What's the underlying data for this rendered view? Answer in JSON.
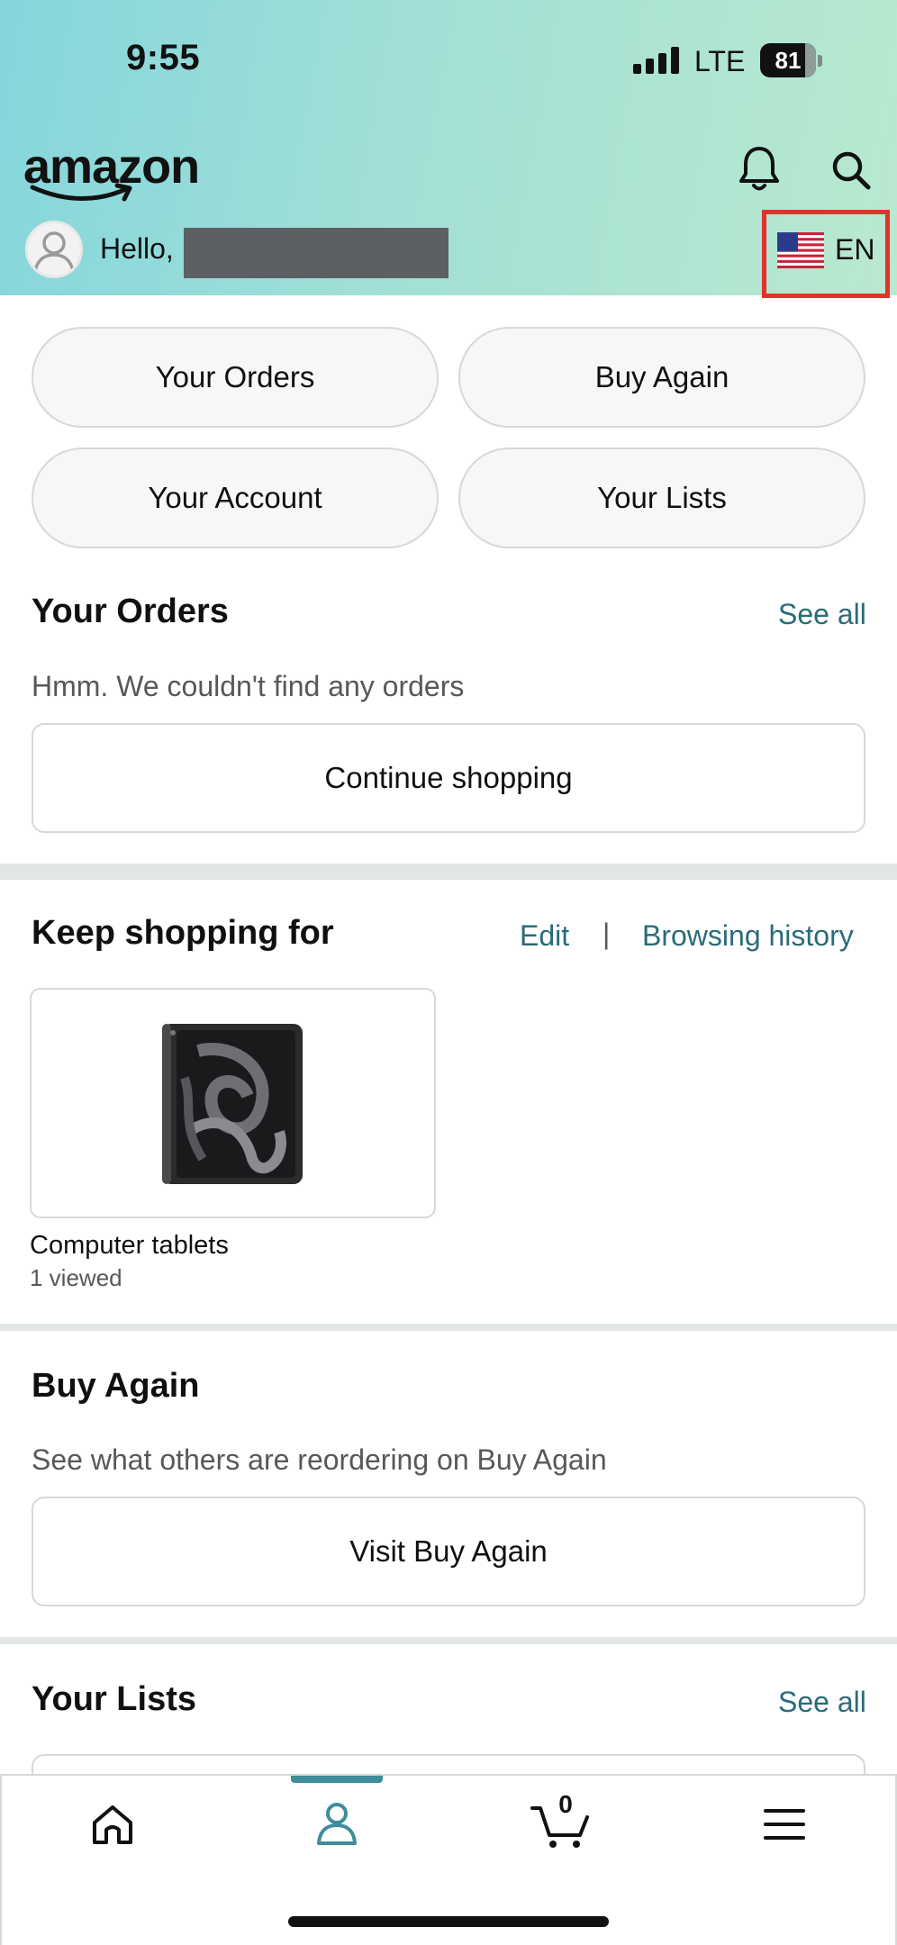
{
  "status_bar": {
    "time": "9:55",
    "network": "LTE",
    "battery": "81"
  },
  "header": {
    "logo_text": "amazon",
    "greeting": "Hello,",
    "language": "EN",
    "icons": {
      "notifications": "bell-icon",
      "search": "search-icon",
      "flag": "us-flag-icon"
    }
  },
  "quick_actions": [
    "Your Orders",
    "Buy Again",
    "Your Account",
    "Your Lists"
  ],
  "orders": {
    "title": "Your Orders",
    "see_all": "See all",
    "empty_message": "Hmm. We couldn't find any orders",
    "button": "Continue shopping"
  },
  "keep_shopping": {
    "title": "Keep shopping for",
    "edit": "Edit",
    "separator": "|",
    "history": "Browsing history",
    "item": {
      "name": "Computer tablets",
      "viewed": "1 viewed"
    }
  },
  "buy_again": {
    "title": "Buy Again",
    "message": "See what others are reordering on Buy Again",
    "button": "Visit Buy Again"
  },
  "lists": {
    "title": "Your Lists",
    "see_all": "See all"
  },
  "bottom_nav": {
    "items": [
      "home-icon",
      "account-icon",
      "cart-icon",
      "menu-icon"
    ],
    "active": "account-icon",
    "cart_count": "0"
  },
  "colors": {
    "link": "#2a6b78",
    "highlight_box": "#e0332b",
    "active_nav": "#3f8c9a"
  }
}
